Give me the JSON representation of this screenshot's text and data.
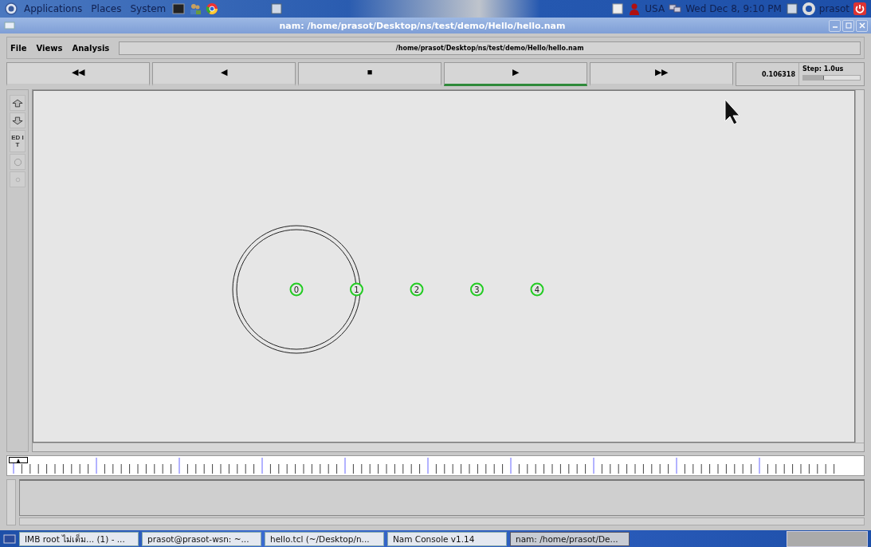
{
  "top_panel": {
    "menus": [
      "Applications",
      "Places",
      "System"
    ],
    "keyboard_layout": "USA",
    "clock": "Wed Dec  8,  9:10 PM",
    "user": "prasot"
  },
  "window": {
    "title": "nam: /home/prasot/Desktop/ns/test/demo/Hello/hello.nam"
  },
  "menu_bar": {
    "items": [
      "File",
      "Views",
      "Analysis"
    ],
    "file_path": "/home/prasot/Desktop/ns/test/demo/Hello/hello.nam"
  },
  "playback": {
    "buttons": [
      {
        "glyph": "◀◀",
        "selected": false
      },
      {
        "glyph": "◀",
        "selected": false
      },
      {
        "glyph": "■",
        "selected": false
      },
      {
        "glyph": "▶",
        "selected": true
      },
      {
        "glyph": "▶▶",
        "selected": false
      }
    ],
    "time": "0.106318",
    "step": {
      "label": "Step: 1.0us",
      "level": 0.35
    }
  },
  "toolbox": [
    {
      "kind": "zoom-in"
    },
    {
      "kind": "zoom-out"
    },
    {
      "kind": "edit",
      "label": "ED IT"
    },
    {
      "kind": "circle"
    },
    {
      "kind": "dot"
    }
  ],
  "network": {
    "nodes": [
      {
        "label": "0",
        "range": true
      },
      {
        "label": "1",
        "range": false
      },
      {
        "label": "2",
        "range": false
      },
      {
        "label": "3",
        "range": false
      },
      {
        "label": "4",
        "range": false
      }
    ]
  },
  "taskbar": {
    "items": [
      {
        "label": "IMB root ไม่เต็ม... (1) - ...",
        "selected": false
      },
      {
        "label": "prasot@prasot-wsn: ~...",
        "selected": false
      },
      {
        "label": "hello.tcl (~/Desktop/n...",
        "selected": false
      },
      {
        "label": "Nam Console v1.14",
        "selected": false
      },
      {
        "label": "nam: /home/prasot/De...",
        "selected": true
      }
    ]
  }
}
